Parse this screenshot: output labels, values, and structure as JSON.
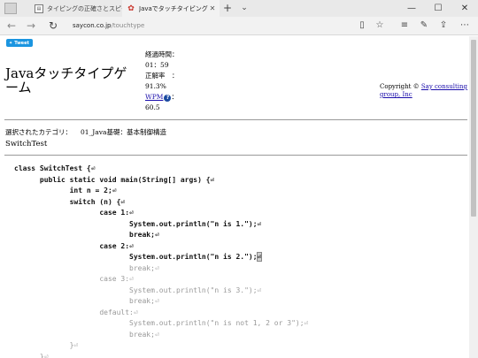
{
  "browser": {
    "tabs": [
      {
        "title": "タイピングの正確さとスピードを表",
        "active": false
      },
      {
        "title": "Javaでタッチタイピングゲーム",
        "active": true
      }
    ],
    "address": {
      "host": "saycon.co.jp",
      "path": "/touchtype"
    }
  },
  "page": {
    "tweet_label": "Tweet",
    "title": "Javaタッチタイプゲーム",
    "stats": {
      "elapsed_label": "経過時間：",
      "elapsed_value": "01：59",
      "accuracy_label": "正解率　：",
      "accuracy_value": "91.3%",
      "wpm_label": "WPM",
      "wpm_suffix": "：",
      "wpm_value": "60.5"
    },
    "copyright_prefix": "Copyright ©",
    "copyright_link": "Say consulting group, Inc",
    "category_label": "選択されたカテゴリ：",
    "category_value": "01_Java基礎：基本制御構造",
    "exercise_name": "SwitchTest",
    "code": {
      "typed": [
        "class SwitchTest {⏎",
        "      public static void main(String[] args) {⏎",
        "             int n = 2;⏎",
        "             switch (n) {⏎",
        "                    case 1:⏎",
        "                           System.out.println(\"n is 1.\");⏎",
        "                           break;⏎",
        "                    case 2:⏎"
      ],
      "current_typed": "                           System.out.println(\"n is 2.\");",
      "cursor_char": "⏎",
      "untyped": [
        "                           break;⏎",
        "                    case 3:⏎",
        "                           System.out.println(\"n is 3.\");⏎",
        "                           break;⏎",
        "                    default:⏎",
        "                           System.out.println(\"n is not 1, 2 or 3\");⏎",
        "                           break;⏎",
        "             }⏎",
        "      }⏎"
      ]
    }
  }
}
